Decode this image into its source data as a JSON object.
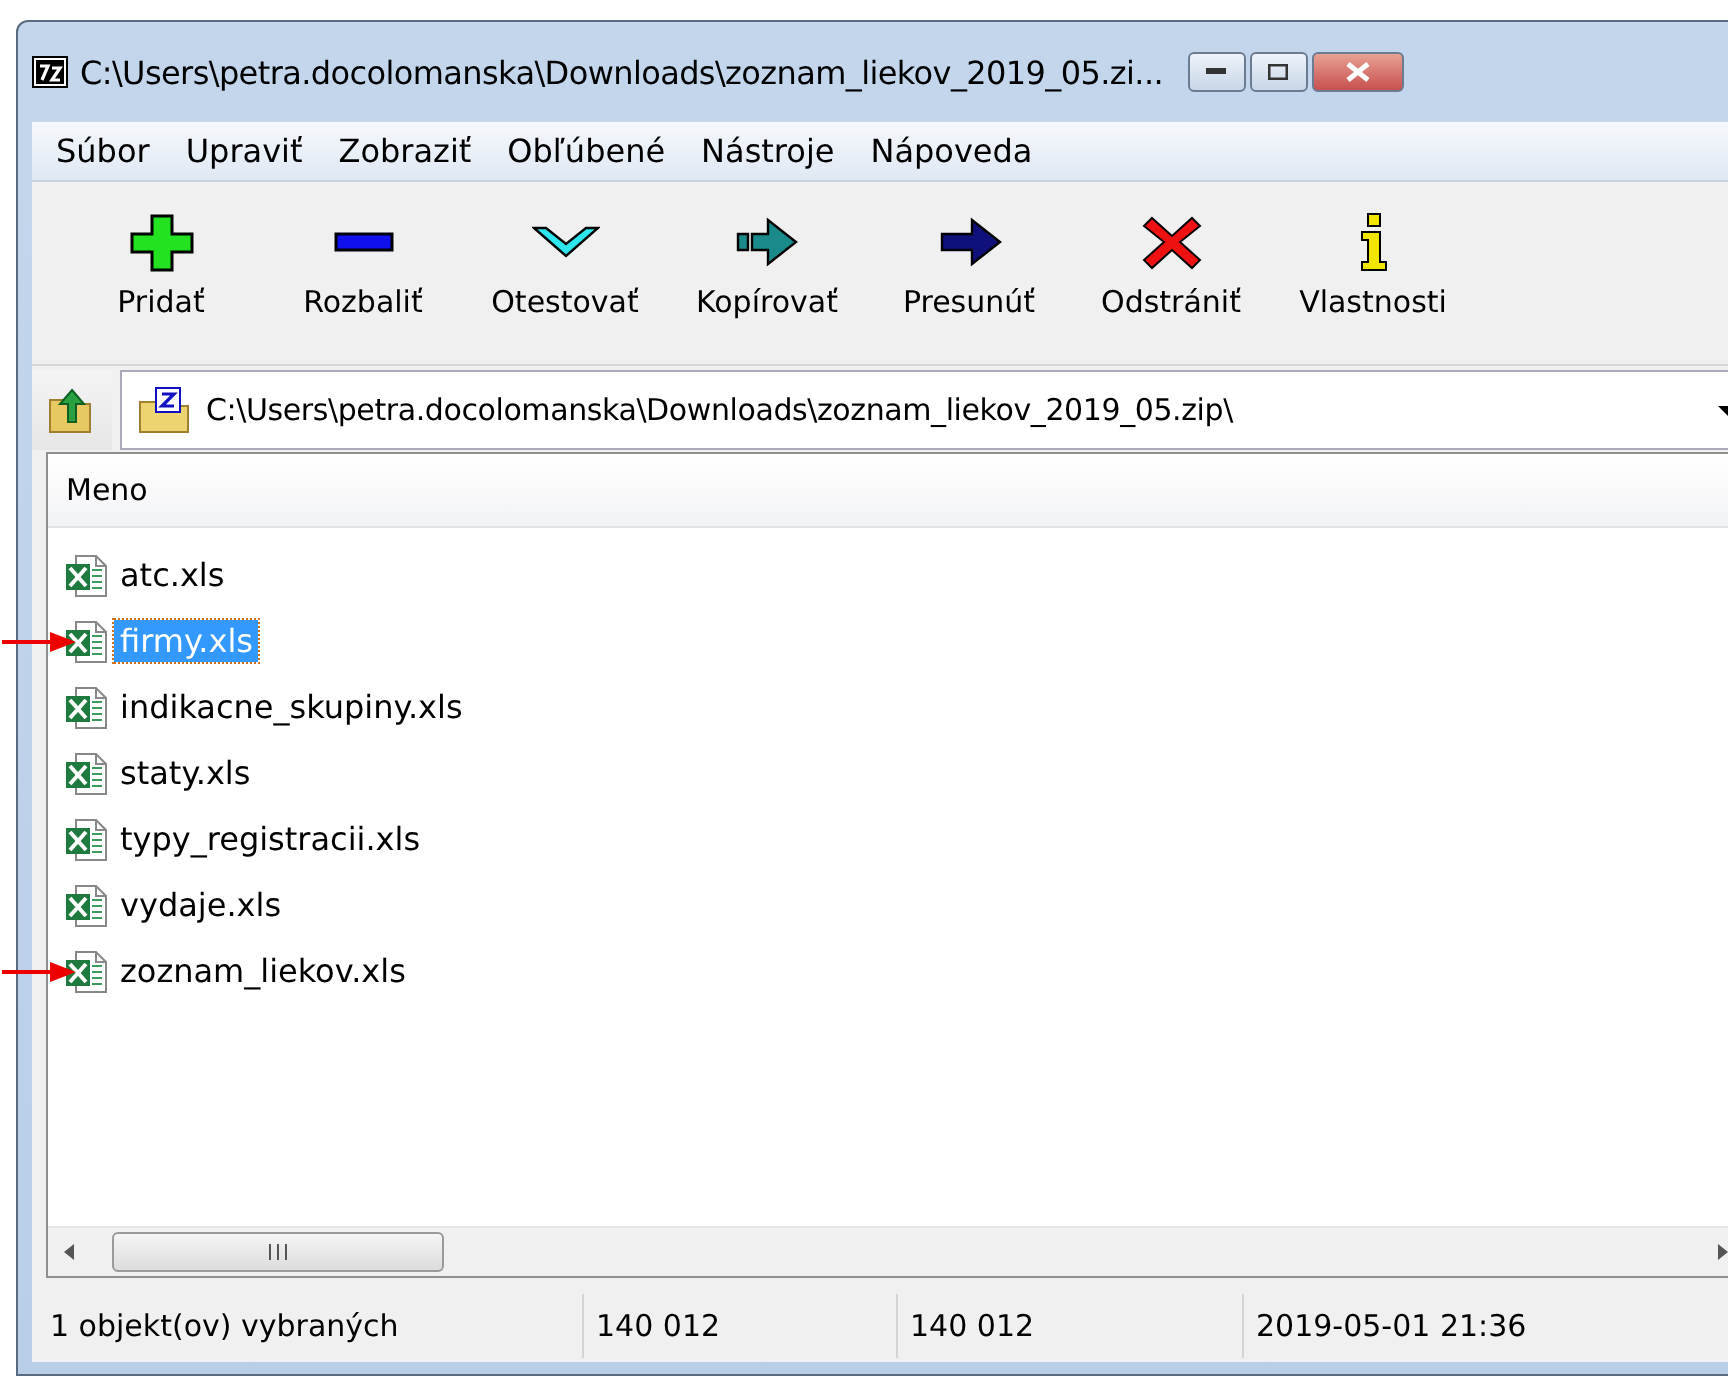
{
  "window": {
    "title": "C:\\Users\\petra.docolomanska\\Downloads\\zoznam_liekov_2019_05.zi..."
  },
  "menu": [
    "Súbor",
    "Upraviť",
    "Zobraziť",
    "Obľúbené",
    "Nástroje",
    "Nápoveda"
  ],
  "toolbar": [
    {
      "kind": "add",
      "label": "Pridať"
    },
    {
      "kind": "extract",
      "label": "Rozbaliť"
    },
    {
      "kind": "test",
      "label": "Otestovať"
    },
    {
      "kind": "copy",
      "label": "Kopírovať"
    },
    {
      "kind": "move",
      "label": "Presunúť"
    },
    {
      "kind": "delete",
      "label": "Odstrániť"
    },
    {
      "kind": "info",
      "label": "Vlastnosti"
    }
  ],
  "address": {
    "value": "C:\\Users\\petra.docolomanska\\Downloads\\zoznam_liekov_2019_05.zip\\"
  },
  "list": {
    "columns": [
      "Meno"
    ],
    "rows": [
      {
        "name": "atc.xls",
        "selected": false,
        "arrow": false
      },
      {
        "name": "firmy.xls",
        "selected": true,
        "arrow": true
      },
      {
        "name": "indikacne_skupiny.xls",
        "selected": false,
        "arrow": false
      },
      {
        "name": "staty.xls",
        "selected": false,
        "arrow": false
      },
      {
        "name": "typy_registracii.xls",
        "selected": false,
        "arrow": false
      },
      {
        "name": "vydaje.xls",
        "selected": false,
        "arrow": false
      },
      {
        "name": "zoznam_liekov.xls",
        "selected": false,
        "arrow": true
      }
    ]
  },
  "status_bar": [
    "1 objekt(ov) vybraných",
    "140 012",
    "140 012",
    "2019-05-01 21:36"
  ]
}
